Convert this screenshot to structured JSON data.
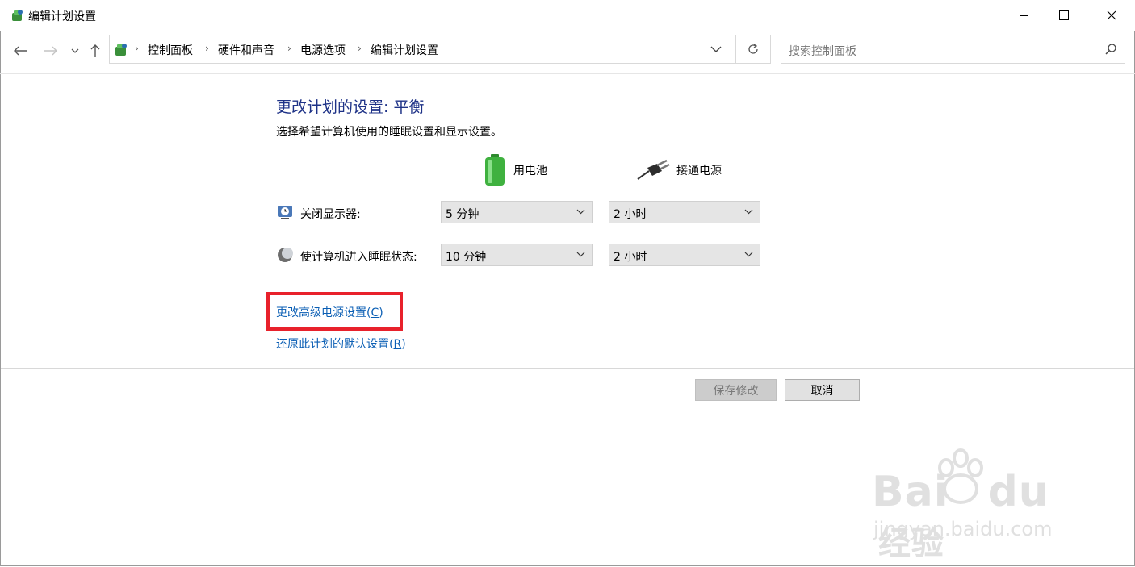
{
  "window": {
    "title": "编辑计划设置"
  },
  "addressbar": {
    "breadcrumbs": [
      "控制面板",
      "硬件和声音",
      "电源选项",
      "编辑计划设置"
    ],
    "search_placeholder": "搜索控制面板"
  },
  "main": {
    "heading": "更改计划的设置: 平衡",
    "subtitle": "选择希望计算机使用的睡眠设置和显示设置。",
    "columns": {
      "battery": "用电池",
      "plugged_in": "接通电源"
    },
    "rows": [
      {
        "label": "关闭显示器:",
        "battery_value": "5 分钟",
        "plugged_value": "2 小时"
      },
      {
        "label": "使计算机进入睡眠状态:",
        "battery_value": "10 分钟",
        "plugged_value": "2 小时"
      }
    ],
    "advanced_link": {
      "text": "更改高级电源设置(",
      "key": "C",
      "close": ")"
    },
    "restore_link": {
      "text": "还原此计划的默认设置(",
      "key": "R",
      "close": ")"
    }
  },
  "buttons": {
    "save": "保存修改",
    "cancel": "取消"
  },
  "annotation": {
    "highlight_color": "#e8212b"
  },
  "watermark": {
    "brand": "Bai",
    "brand_tail": "经验",
    "brand_du": "du",
    "url": "jingyan.baidu.com"
  }
}
